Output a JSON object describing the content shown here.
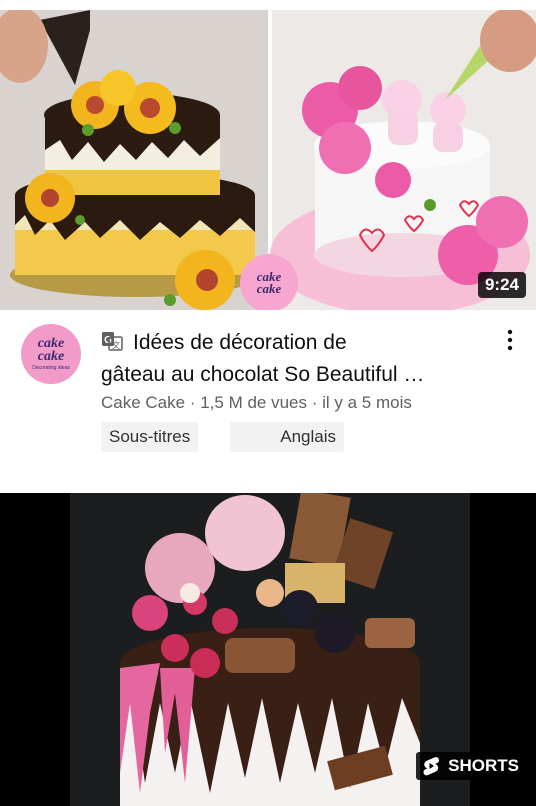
{
  "videos": [
    {
      "duration": "9:24",
      "watermark": {
        "line1": "cake",
        "line2": "cake"
      },
      "avatar": {
        "line1": "cake",
        "line2": "cake",
        "tagline": "Decorating ideas"
      },
      "translate_icon": "translate-icon",
      "title_line1": "Idées de décoration de",
      "title_line2": "gâteau au chocolat So Beautiful …",
      "channel": "Cake Cake",
      "views": "1,5 M de vues",
      "age": "il y a 5 mois",
      "separator": " · ",
      "badges": [
        "Sous-titres",
        "Anglais"
      ],
      "menu_icon": "more-vert-icon"
    },
    {
      "shorts_label": "SHORTS",
      "shorts_icon": "shorts-icon"
    }
  ],
  "colors": {
    "text_primary": "#0f0f0f",
    "text_secondary": "#606060",
    "badge_bg": "#f2f2f2",
    "duration_bg": "#000000",
    "avatar_bg": "#f29bc9"
  }
}
